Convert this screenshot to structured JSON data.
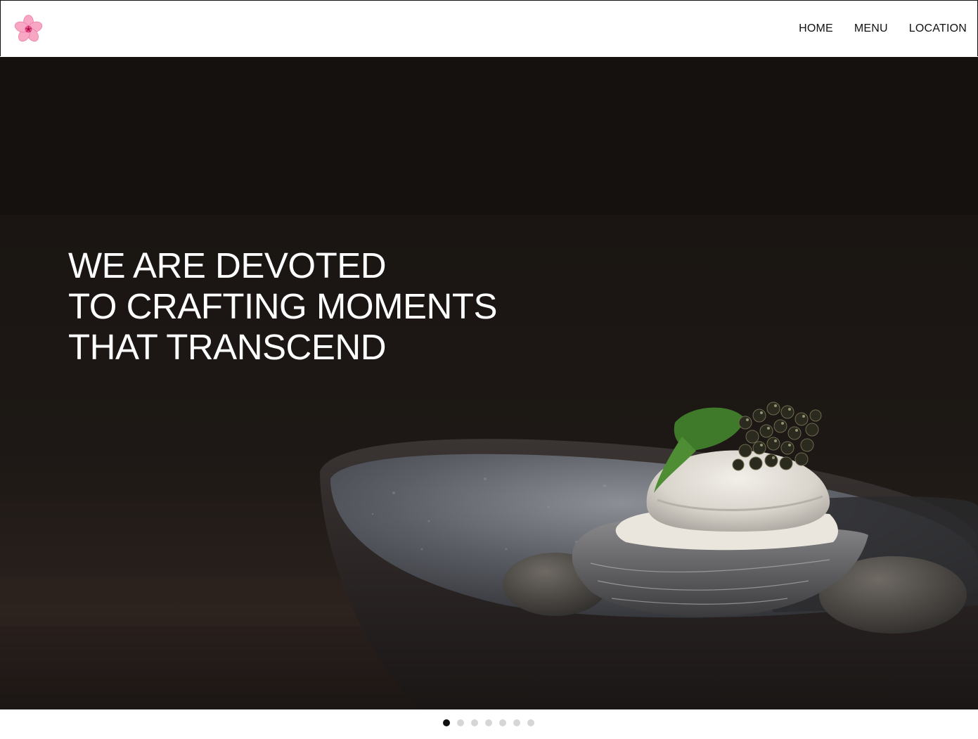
{
  "header": {
    "logo_icon": "cherry-blossom-icon",
    "nav": [
      {
        "label": "HOME"
      },
      {
        "label": "MENU"
      },
      {
        "label": "LOCATION"
      }
    ]
  },
  "hero": {
    "headline_lines": [
      "WE ARE DEVOTED",
      "TO CRAFTING MOMENTS",
      "THAT TRANSCEND"
    ],
    "image": "oyster-with-caviar-in-stone-bowl"
  },
  "carousel": {
    "slide_count": 7,
    "active_index": 0
  },
  "colors": {
    "hero_background": "#15110e",
    "headline_text": "#ffffff",
    "logo_pink": "#f7a6c4",
    "active_dot": "#111111",
    "inactive_dot": "#d6d6d6"
  }
}
